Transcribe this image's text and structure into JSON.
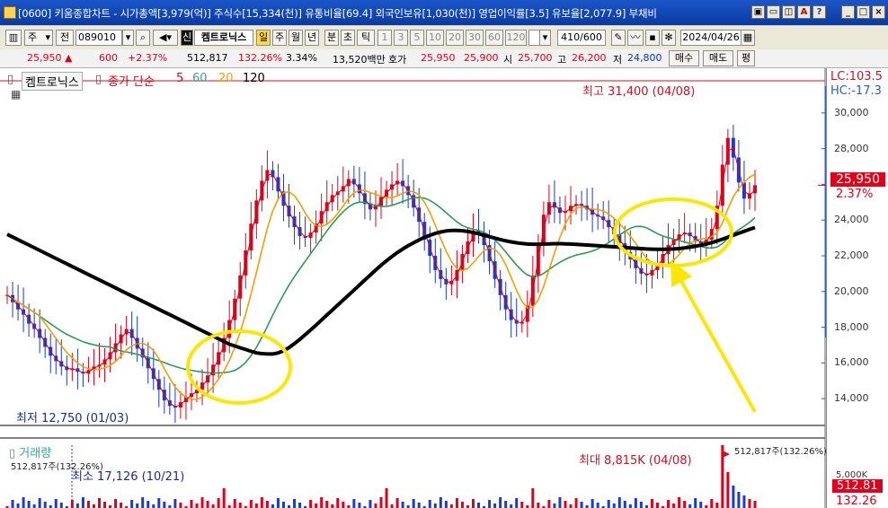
{
  "titlebar": {
    "title": "[0600] 키움종합차트 - 시가총액[3,979(억)] 주식수[15,334(천)] 유통비율[69.4] 외국인보유[1,030(천)] 영업이익률[3.5] 유보율[2,077.9] 부채비"
  },
  "toolbar": {
    "market": "주",
    "prev_btn": "전",
    "code": "089010",
    "stock_name": "켐트로닉스",
    "period_day": "일",
    "period_week": "주",
    "period_month": "월",
    "period_year": "년",
    "period_min": "분",
    "period_sec": "초",
    "period_tick": "틱",
    "intervals": [
      "1",
      "3",
      "5",
      "10",
      "20",
      "30",
      "60",
      "120"
    ],
    "count": "410/600",
    "date": "2024/04/26"
  },
  "quote": {
    "price": "25,950",
    "arrow": "▲",
    "change": "600",
    "change_pct": "+2.37%",
    "volume": "512,817",
    "vol_ratio": "132.26%",
    "turnover": "3.34%",
    "amount": "13,520백만",
    "hoga_label": "호가",
    "ask": "25,950",
    "bid": "25,900",
    "open_label": "시",
    "open": "25,700",
    "high_label": "고",
    "high": "26,200",
    "low_label": "저",
    "low": "24,800",
    "buy_btn": "매수",
    "sell_btn": "매도",
    "eval_btn": "평"
  },
  "legend": {
    "name": "켐트로닉스",
    "ma_label": "종가 단순",
    "ma5": "5",
    "ma60": "60",
    "ma20": "20",
    "ma120": "120",
    "ma5_color": "#e0001a",
    "ma20_color": "#f0a000",
    "ma60_color": "#2e9a5a",
    "ma120_color": "#000000"
  },
  "annotations": {
    "high_text": "최고 31,400 (04/08)",
    "low_text": "최저 12,750 (01/03)",
    "lc": "LC:103.5",
    "hc": "HC:-17.3",
    "last_price": "25,950",
    "last_pct": "2.37%"
  },
  "volume_panel": {
    "title": "거래량",
    "current_label": "512,817주(132.26%)",
    "current_label_right": "512,817주(132.26%)",
    "max_text": "최대 8,815K (04/08)",
    "min_text": "최소 17,126 (10/21)",
    "axis_tick": "5,000K",
    "last_value": "512.81",
    "last_pct": "132.26"
  },
  "chart_data": {
    "type": "line",
    "y_ticks": [
      "30,000",
      "28,000",
      "26,000",
      "24,000",
      "22,000",
      "20,000",
      "18,000",
      "16,000",
      "14,000"
    ],
    "ylim": [
      12500,
      31800
    ],
    "close": [
      19800,
      19400,
      19000,
      18700,
      18200,
      17900,
      17400,
      16900,
      16400,
      16100,
      15800,
      15600,
      15700,
      15500,
      15400,
      15600,
      15800,
      15900,
      16200,
      16600,
      17100,
      17600,
      17900,
      17400,
      16800,
      16300,
      15700,
      15100,
      14500,
      13900,
      13600,
      13500,
      13800,
      14100,
      14300,
      14500,
      14900,
      15300,
      15900,
      16600,
      17400,
      18400,
      19600,
      20900,
      22300,
      23800,
      25100,
      26200,
      26800,
      26400,
      25600,
      24800,
      24200,
      23600,
      23100,
      23000,
      23300,
      23800,
      24500,
      25000,
      25400,
      25600,
      25900,
      26300,
      26000,
      25500,
      24900,
      24600,
      24800,
      25300,
      25700,
      26000,
      26200,
      25900,
      25400,
      24700,
      23900,
      22900,
      22000,
      21200,
      20700,
      20400,
      20600,
      21200,
      22100,
      22800,
      23400,
      23300,
      22600,
      21700,
      20700,
      19800,
      19000,
      18400,
      18200,
      18300,
      19200,
      20900,
      22700,
      24300,
      25000,
      24700,
      24400,
      24500,
      24800,
      24900,
      24800,
      24600,
      24300,
      24200,
      24000,
      23600,
      23200,
      22700,
      22200,
      21800,
      21300,
      21000,
      20900,
      21200,
      21600,
      22100,
      22600,
      22900,
      23200,
      23300,
      23100,
      22800,
      22700,
      22900,
      23500,
      24800,
      27100,
      28600,
      27500,
      26100,
      25200,
      25500,
      25950
    ],
    "ma120": [
      23200,
      23050,
      22900,
      22750,
      22600,
      22450,
      22300,
      22150,
      22000,
      21850,
      21700,
      21550,
      21400,
      21250,
      21100,
      20950,
      20800,
      20650,
      20500,
      20350,
      20200,
      20050,
      19900,
      19750,
      19600,
      19450,
      19300,
      19150,
      19000,
      18850,
      18700,
      18550,
      18400,
      18250,
      18100,
      17950,
      17800,
      17650,
      17500,
      17350,
      17200,
      17050,
      16950,
      16850,
      16750,
      16650,
      16560,
      16520,
      16500,
      16500,
      16560,
      16680,
      16860,
      17080,
      17320,
      17580,
      17850,
      18120,
      18400,
      18680,
      18960,
      19240,
      19520,
      19800,
      20080,
      20360,
      20640,
      20920,
      21200,
      21470,
      21720,
      21960,
      22180,
      22380,
      22560,
      22730,
      22890,
      23030,
      23150,
      23250,
      23330,
      23390,
      23420,
      23420,
      23400,
      23360,
      23300,
      23230,
      23150,
      23070,
      22990,
      22910,
      22840,
      22780,
      22730,
      22690,
      22660,
      22650,
      22650,
      22660,
      22670,
      22680,
      22680,
      22670,
      22660,
      22640,
      22620,
      22600,
      22580,
      22560,
      22540,
      22520,
      22500,
      22480,
      22460,
      22440,
      22420,
      22400,
      22380,
      22370,
      22360,
      22360,
      22370,
      22380,
      22400,
      22440,
      22480,
      22530,
      22590,
      22660,
      22740,
      22830,
      22930,
      23040,
      23150,
      23260,
      23370,
      23480,
      23580
    ]
  }
}
